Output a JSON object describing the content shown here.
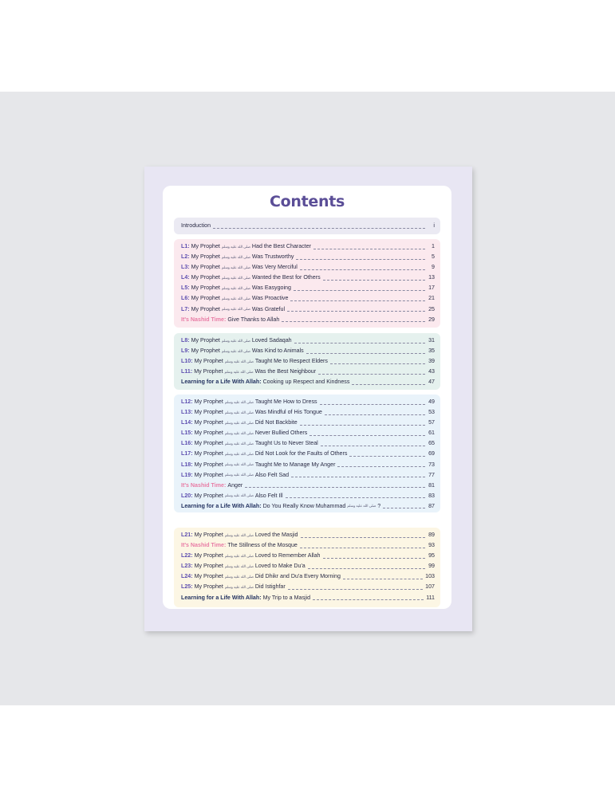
{
  "title": "Contents",
  "sections": [
    {
      "id": "intro",
      "bg": "#ebeaf3",
      "rows": [
        {
          "label": "",
          "segments": [
            "Introduction"
          ],
          "page": "i"
        }
      ]
    },
    {
      "id": "unit1",
      "bg": "#fbe9ee",
      "rows": [
        {
          "label": "L1:",
          "segments": [
            "My Prophet",
            "Had the Best Character"
          ],
          "page": "1"
        },
        {
          "label": "L2:",
          "segments": [
            "My Prophet",
            "Was Trustworthy"
          ],
          "page": "5"
        },
        {
          "label": "L3:",
          "segments": [
            "My Prophet",
            "Was Very Merciful"
          ],
          "page": "9"
        },
        {
          "label": "L4:",
          "segments": [
            "My Prophet",
            "Wanted the Best for Others"
          ],
          "page": "13"
        },
        {
          "label": "L5:",
          "segments": [
            "My Prophet",
            "Was Easygoing"
          ],
          "page": "17"
        },
        {
          "label": "L6:",
          "segments": [
            "My Prophet",
            "Was Proactive"
          ],
          "page": "21"
        },
        {
          "label": "L7:",
          "segments": [
            "My Prophet",
            "Was Grateful"
          ],
          "page": "25"
        },
        {
          "label": "It's Nashid Time:",
          "segments": [
            "Give Thanks to Allah"
          ],
          "page": "29",
          "style": "pink"
        }
      ]
    },
    {
      "id": "unit2",
      "bg": "#e5f1ee",
      "rows": [
        {
          "label": "L8:",
          "segments": [
            "My Prophet",
            "Loved Sadaqah"
          ],
          "page": "31"
        },
        {
          "label": "L9:",
          "segments": [
            "My Prophet",
            "Was Kind to Animals"
          ],
          "page": "35"
        },
        {
          "label": "L10:",
          "segments": [
            "My Prophet",
            "Taught Me to Respect Elders"
          ],
          "page": "39"
        },
        {
          "label": "L11:",
          "segments": [
            "My Prophet",
            "Was the Best Neighbour"
          ],
          "page": "43"
        },
        {
          "label": "Learning for a Life With Allah:",
          "segments": [
            "Cooking up Respect and Kindness"
          ],
          "page": "47",
          "style": "navy"
        }
      ]
    },
    {
      "id": "unit3",
      "bg": "#e9f3fa",
      "rows": [
        {
          "label": "L12:",
          "segments": [
            "My Prophet",
            "Taught Me How to Dress"
          ],
          "page": "49"
        },
        {
          "label": "L13:",
          "segments": [
            "My Prophet",
            "Was Mindful of His Tongue"
          ],
          "page": "53"
        },
        {
          "label": "L14:",
          "segments": [
            "My Prophet",
            "Did Not Backbite"
          ],
          "page": "57"
        },
        {
          "label": "L15:",
          "segments": [
            "My Prophet",
            "Never Bullied Others"
          ],
          "page": "61"
        },
        {
          "label": "L16:",
          "segments": [
            "My Prophet",
            "Taught Us to Never Steal"
          ],
          "page": "65"
        },
        {
          "label": "L17:",
          "segments": [
            "My Prophet",
            "Did Not Look for the Faults of Others"
          ],
          "page": "69"
        },
        {
          "label": "L18:",
          "segments": [
            "My Prophet",
            "Taught Me to Manage My Anger"
          ],
          "page": "73"
        },
        {
          "label": "L19:",
          "segments": [
            "My Prophet",
            "Also Felt Sad"
          ],
          "page": "77"
        },
        {
          "label": "It's Nashid Time:",
          "segments": [
            "Anger"
          ],
          "page": "81",
          "style": "pink"
        },
        {
          "label": "L20:",
          "segments": [
            "My Prophet",
            "Also Felt Ill"
          ],
          "page": "83"
        },
        {
          "label": "Learning for a Life With Allah:",
          "segments": [
            "Do You Really Know Muhammad",
            "?"
          ],
          "page": "87",
          "style": "navy"
        }
      ]
    },
    {
      "id": "unit4",
      "bg": "#fcf6e4",
      "rows": [
        {
          "label": "L21:",
          "segments": [
            "My Prophet",
            "Loved the Masjid"
          ],
          "page": "89"
        },
        {
          "label": "It's Nashid Time:",
          "segments": [
            "The Stillness of the Mosque"
          ],
          "page": "93",
          "style": "pink"
        },
        {
          "label": "L22:",
          "segments": [
            "My Prophet",
            "Loved to Remember Allah"
          ],
          "page": "95"
        },
        {
          "label": "L23:",
          "segments": [
            "My Prophet",
            "Loved to Make Du'a"
          ],
          "page": "99"
        },
        {
          "label": "L24:",
          "segments": [
            "My Prophet",
            "Did Dhikr and Du'a Every Morning"
          ],
          "page": "103"
        },
        {
          "label": "L25:",
          "segments": [
            "My Prophet",
            "Did Istighfar"
          ],
          "page": "107"
        },
        {
          "label": "Learning for a Life With Allah:",
          "segments": [
            "My Trip to a Masjid"
          ],
          "page": "111",
          "style": "navy"
        }
      ]
    }
  ],
  "honorific": "صلى الله عليه وسلم",
  "colors": {
    "title": "#5b4e97",
    "lesson_label": "#5e4fb0",
    "nashid_label": "#e87ca5",
    "learning_label": "#233260",
    "page_background": "#e8e6f3"
  }
}
